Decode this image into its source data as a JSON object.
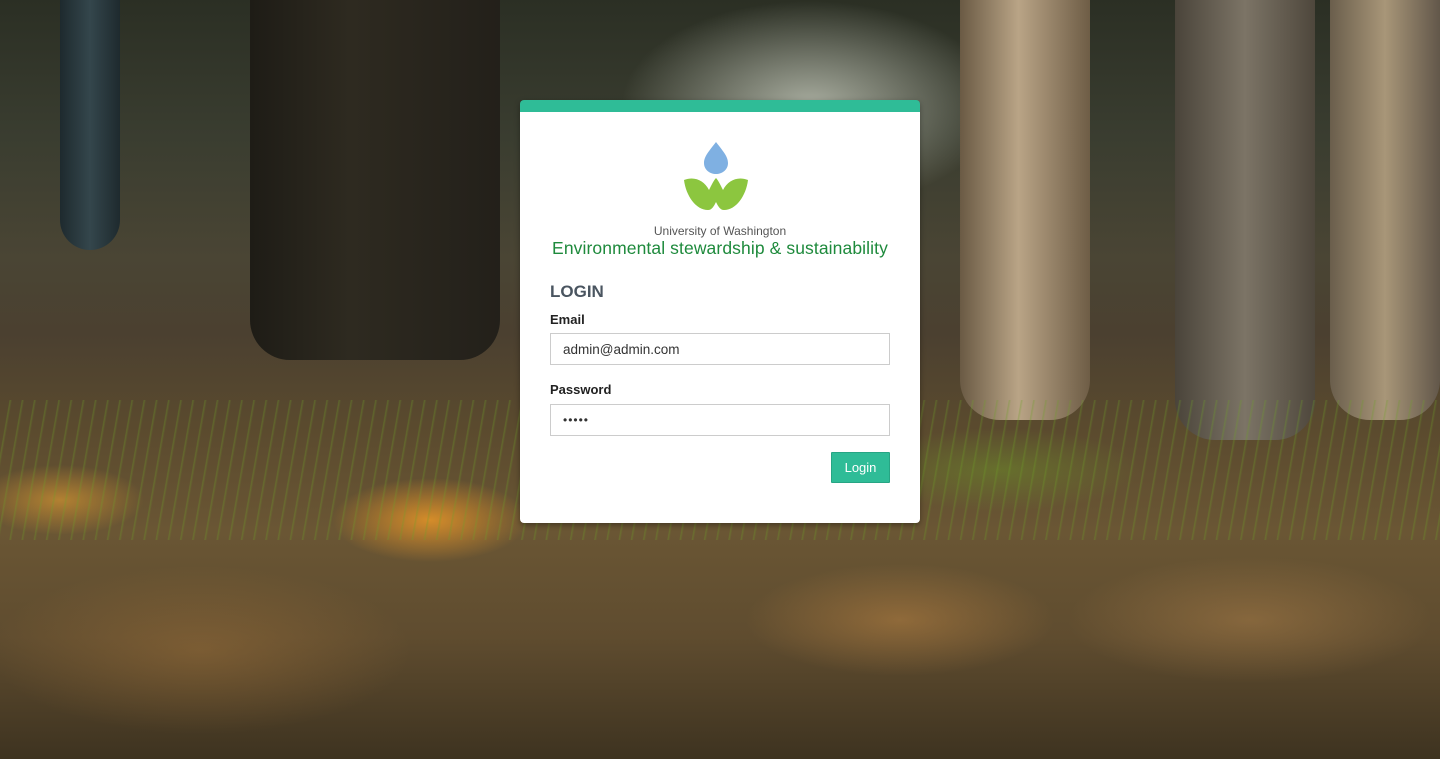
{
  "brand": {
    "logo_icon": "uw-leaf-drop-icon",
    "institution": "University of Washington",
    "title": "Environmental stewardship & sustainability",
    "colors": {
      "accent": "#2fbc97",
      "brand_green": "#1e8a3c",
      "drop_blue": "#7fb0e2",
      "leaf_green": "#8cc63f"
    }
  },
  "login": {
    "heading": "LOGIN",
    "email_label": "Email",
    "email_value": "admin@admin.com",
    "password_label": "Password",
    "password_value": "•••••",
    "submit_label": "Login"
  }
}
